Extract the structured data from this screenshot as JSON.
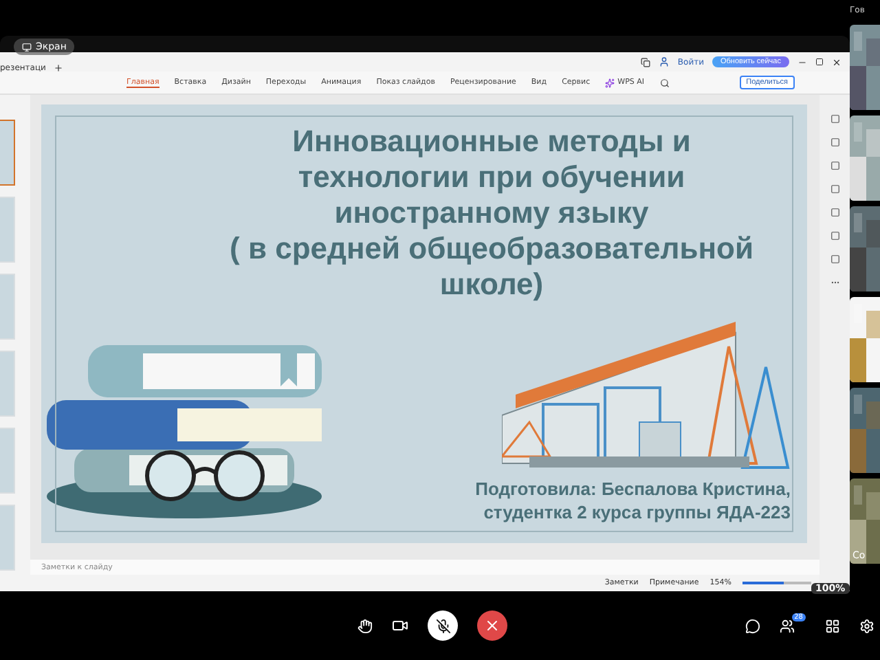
{
  "call_header": {
    "speaker_label": "Гов"
  },
  "screen_share": {
    "label": "Экран"
  },
  "title_bar": {
    "document_tab": "резентаци",
    "login": "Войти",
    "update_button": "Обновить сейчас"
  },
  "ribbon": {
    "tabs": [
      {
        "label": "Главная",
        "selected": true
      },
      {
        "label": "Вставка",
        "selected": false
      },
      {
        "label": "Дизайн",
        "selected": false
      },
      {
        "label": "Переходы",
        "selected": false
      },
      {
        "label": "Анимация",
        "selected": false
      },
      {
        "label": "Показ слайдов",
        "selected": false
      },
      {
        "label": "Рецензирование",
        "selected": false
      },
      {
        "label": "Вид",
        "selected": false
      },
      {
        "label": "Сервис",
        "selected": false
      }
    ],
    "ai_button": "WPS AI",
    "share_button": "Поделиться"
  },
  "thumbnails": [
    {
      "selected": true
    },
    {
      "selected": false
    },
    {
      "selected": false
    },
    {
      "selected": false
    },
    {
      "selected": false
    },
    {
      "selected": false
    }
  ],
  "slide": {
    "title_lines": [
      "Инновационные методы и",
      "технологии при обучении",
      "иностранному языку",
      "( в средней общеобразовательной",
      "школе)"
    ],
    "author_lines": [
      "Подготовила: Беспалова Кристина,",
      "студентка 2 курса группы ЯДА-223"
    ]
  },
  "notes": {
    "placeholder": "Заметки к слайду"
  },
  "status_bar": {
    "notes_button": "Заметки",
    "comment_button": "Примечание",
    "zoom": "154%",
    "zoom_slider": {
      "level": 0.6
    }
  },
  "call_zoom": "100%",
  "participants": {
    "count": "28",
    "tiles": [
      {
        "kind": "picture"
      },
      {
        "kind": "picture"
      },
      {
        "kind": "picture"
      },
      {
        "kind": "picture"
      },
      {
        "kind": "picture"
      },
      {
        "kind": "picture",
        "label": "Co"
      }
    ]
  },
  "call_controls": {
    "mic_muted": true
  }
}
